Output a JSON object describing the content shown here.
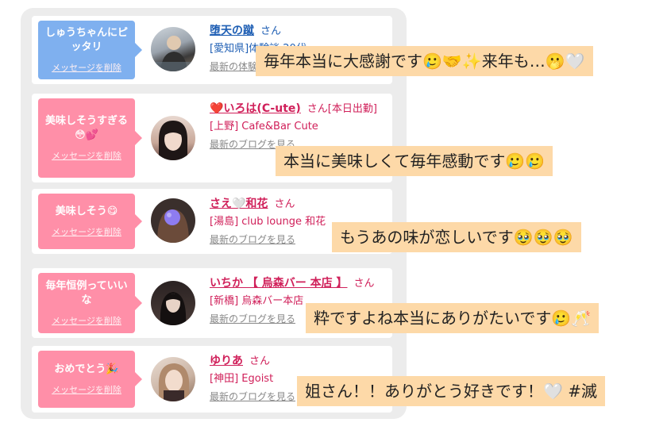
{
  "cards": [
    {
      "message": "しゅうちゃんにピッタリ",
      "delete_label": "メッセージを削除",
      "name": "堕天の蹴",
      "suffix": "さん",
      "location": "[愛知県]体験談 20代",
      "blog_link": "最新の体験談を見る"
    },
    {
      "message": "美味しそうすぎる😳💕",
      "delete_label": "メッセージを削除",
      "name": "❤️いろは(C-ute)",
      "suffix": "さん[本日出勤]",
      "location": "[上野] Cafe&Bar Cute",
      "blog_link": "最新のブログを見る"
    },
    {
      "message": "美味しそう😋",
      "delete_label": "メッセージを削除",
      "name": "さえ🤍和花",
      "suffix": "さん",
      "location": "[湯島] club lounge 和花",
      "blog_link": "最新のブログを見る"
    },
    {
      "message": "毎年恒例っていいな",
      "delete_label": "メッセージを削除",
      "name": "いちか 【 烏森バー 本店 】",
      "suffix": "さん",
      "location": "[新橋] 烏森バー本店",
      "blog_link": "最新のブログを見る"
    },
    {
      "message": "おめでとう🎉",
      "delete_label": "メッセージを削除",
      "name": "ゆりあ",
      "suffix": "さん",
      "location": "[神田] Egoist",
      "blog_link": "最新のブログを見る"
    }
  ],
  "overlays": [
    "毎年本当に大感謝です🥲🤝✨来年も…🫢🤍",
    "本当に美味しくて毎年感動です🥲🥲",
    "もうあの味が恋しいです🥹🥹🥹",
    "粋ですよね本当にありがたいです🥲🥂",
    "姐さん！！ありがとう好きです！🤍 #滅"
  ],
  "colors": {
    "blue_bubble": "#7fb0ef",
    "pink_bubble": "#ff8fa8",
    "overlay_bg": "#fdd9a8",
    "panel_bg": "#ececec"
  }
}
